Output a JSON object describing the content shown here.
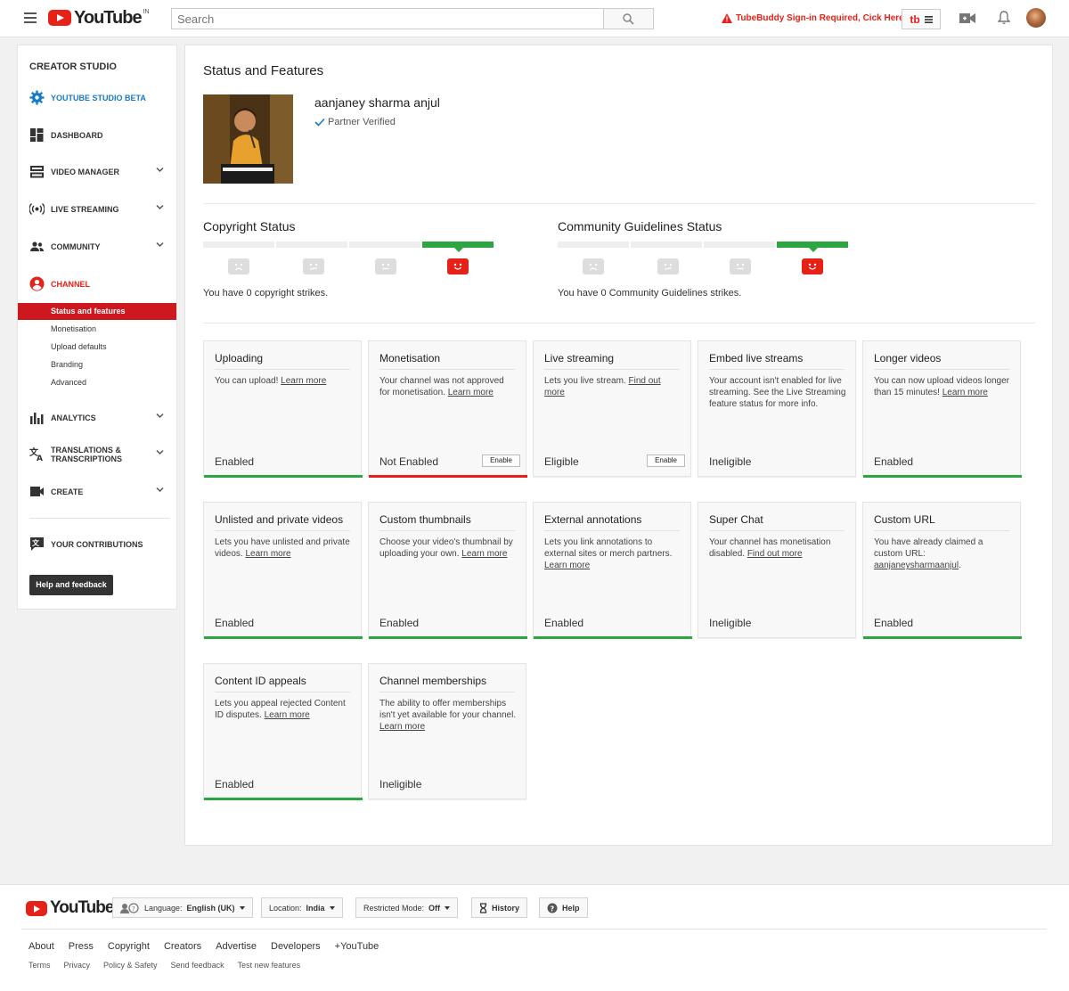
{
  "header": {
    "logo_text": "YouTube",
    "country_code": "IN",
    "search_placeholder": "Search",
    "tubebuddy_warning": "TubeBuddy Sign-in Required, Cick Here",
    "tubebuddy_badge": "tb"
  },
  "sidebar": {
    "title": "CREATOR STUDIO",
    "items": [
      {
        "label": "YOUTUBE STUDIO BETA",
        "icon": "gear-icon",
        "color": "#167ac6"
      },
      {
        "label": "DASHBOARD",
        "icon": "dashboard-icon"
      },
      {
        "label": "VIDEO MANAGER",
        "icon": "video-manager-icon"
      },
      {
        "label": "LIVE STREAMING",
        "icon": "live-icon"
      },
      {
        "label": "COMMUNITY",
        "icon": "people-icon"
      },
      {
        "label": "CHANNEL",
        "icon": "account-icon",
        "color": "#e62117"
      }
    ],
    "channel_subitems": [
      "Status and features",
      "Monetisation",
      "Upload defaults",
      "Branding",
      "Advanced"
    ],
    "items_after": [
      {
        "label": "ANALYTICS",
        "icon": "bar-chart-icon"
      },
      {
        "label": "TRANSLATIONS &",
        "label2": "TRANSCRIPTIONS",
        "icon": "translate-icon"
      },
      {
        "label": "CREATE",
        "icon": "camera-icon"
      }
    ],
    "contributions": "YOUR CONTRIBUTIONS",
    "help_button": "Help and feedback"
  },
  "main": {
    "title": "Status and Features",
    "channel_name": "aanjaney sharma anjul",
    "verified_label": "Partner Verified",
    "copyright": {
      "title": "Copyright Status",
      "text": "You have 0 copyright strikes.",
      "strikes": 0
    },
    "community": {
      "title": "Community Guidelines Status",
      "text": "You have 0 Community Guidelines strikes.",
      "strikes": 0
    },
    "cards": [
      {
        "title": "Uploading",
        "desc": "You can upload! ",
        "link": "Learn more",
        "desc_after": "",
        "status": "Enabled",
        "bar": "green",
        "button": ""
      },
      {
        "title": "Monetisation",
        "desc": "Your channel was not approved for monetisation. ",
        "link": "Learn more",
        "desc_after": "",
        "status": "Not Enabled",
        "bar": "red",
        "button": "Enable"
      },
      {
        "title": "Live streaming",
        "desc": "Lets you live stream. ",
        "link": "Find out more",
        "desc_after": "",
        "status": "Eligible",
        "bar": "none",
        "button": "Enable"
      },
      {
        "title": "Embed live streams",
        "desc": "Your account isn't enabled for live streaming. See the Live Streaming feature status for more info.",
        "link": "",
        "desc_after": "",
        "status": "Ineligible",
        "bar": "none",
        "button": ""
      },
      {
        "title": "Longer videos",
        "desc": "You can now upload videos longer than 15 minutes! ",
        "link": "Learn more",
        "desc_after": "",
        "status": "Enabled",
        "bar": "green",
        "button": ""
      },
      {
        "title": "Unlisted and private videos",
        "desc": "Lets you have unlisted and private videos. ",
        "link": "Learn more",
        "desc_after": "",
        "status": "Enabled",
        "bar": "green",
        "button": ""
      },
      {
        "title": "Custom thumbnails",
        "desc": "Choose your video's thumbnail by uploading your own. ",
        "link": "Learn more",
        "desc_after": "",
        "status": "Enabled",
        "bar": "green",
        "button": ""
      },
      {
        "title": "External annotations",
        "desc": "Lets you link annotations to external sites or merch partners. ",
        "link": "Learn more",
        "desc_after": "",
        "status": "Enabled",
        "bar": "green",
        "button": ""
      },
      {
        "title": "Super Chat",
        "desc": "Your channel has monetisation disabled. ",
        "link": "Find out more",
        "desc_after": "",
        "status": "Ineligible",
        "bar": "none",
        "button": ""
      },
      {
        "title": "Custom URL",
        "desc": "You have already claimed a custom URL: ",
        "link": "aanjaneysharmaanjul",
        "desc_after": ".",
        "status": "Enabled",
        "bar": "green",
        "button": ""
      },
      {
        "title": "Content ID appeals",
        "desc": "Lets you appeal rejected Content ID disputes. ",
        "link": "Learn more",
        "desc_after": "",
        "status": "Enabled",
        "bar": "green",
        "button": ""
      },
      {
        "title": "Channel memberships",
        "desc": "The ability to offer memberships isn't yet available for your channel. ",
        "link": "Learn more",
        "desc_after": "",
        "status": "Ineligible",
        "bar": "none",
        "button": ""
      }
    ]
  },
  "footer": {
    "logo_text": "YouTube",
    "language_label": "Language:",
    "language_value": "English (UK)",
    "location_label": "Location:",
    "location_value": "India",
    "restricted_label": "Restricted Mode:",
    "restricted_value": "Off",
    "history": "History",
    "help": "Help",
    "links": [
      "About",
      "Press",
      "Copyright",
      "Creators",
      "Advertise",
      "Developers",
      "+YouTube"
    ],
    "links2": [
      "Terms",
      "Privacy",
      "Policy & Safety",
      "Send feedback",
      "Test new features"
    ]
  },
  "colors": {
    "accent": "#e62117",
    "green": "#2ba640",
    "blue": "#167ac6"
  }
}
